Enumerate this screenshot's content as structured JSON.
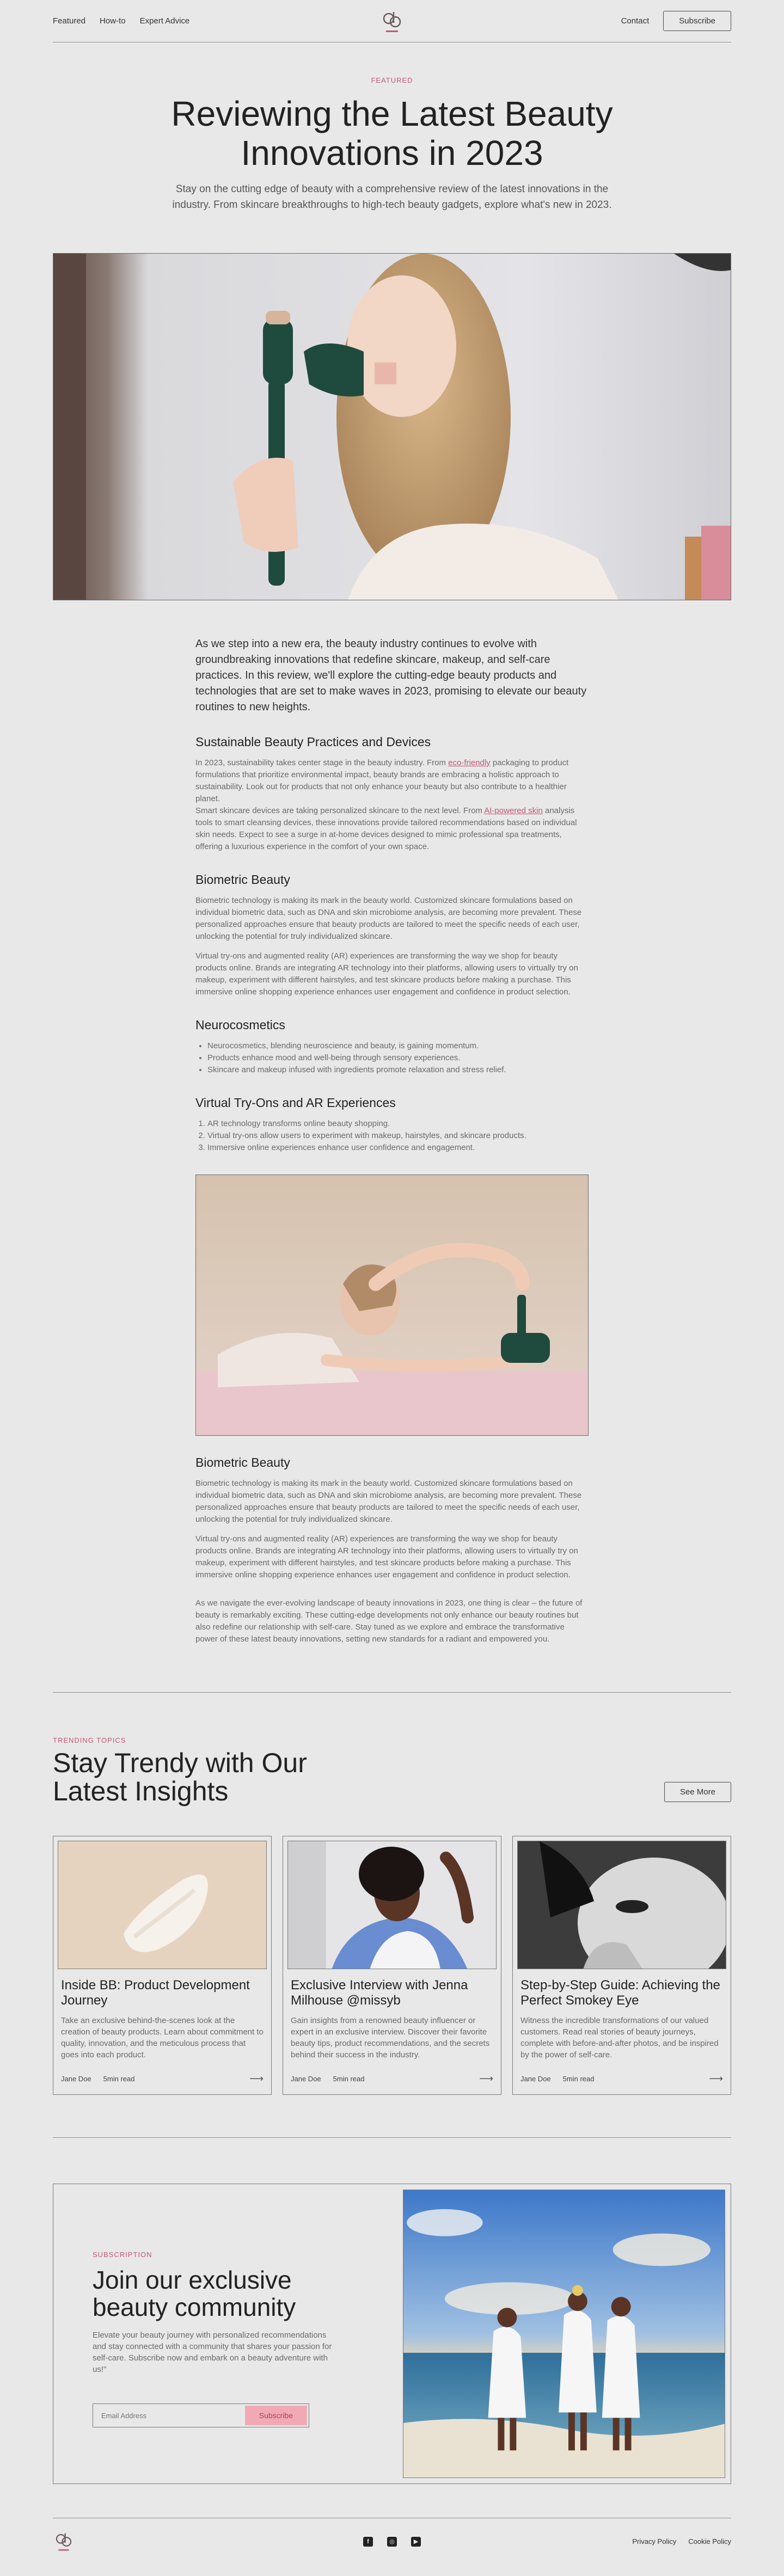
{
  "nav": {
    "featured": "Featured",
    "howto": "How-to",
    "expert": "Expert Advice",
    "contact": "Contact",
    "subscribe": "Subscribe"
  },
  "hero": {
    "eyebrow": "FEATURED",
    "title_line1": "Reviewing the Latest Beauty",
    "title_line2": "Innovations in 2023",
    "subtitle": "Stay on the cutting edge of beauty with a comprehensive review of the latest innovations in the industry. From skincare breakthroughs to high-tech beauty gadgets, explore what's new in 2023."
  },
  "article": {
    "lead": "As we step into a new era, the beauty industry continues to evolve with groundbreaking innovations that redefine skincare, makeup, and self-care practices. In this review, we'll explore the cutting-edge beauty products and technologies that are set to make waves in 2023, promising to elevate our beauty routines to new heights.",
    "h_sustainable": "Sustainable Beauty Practices and Devices",
    "p_sust_1a": "In 2023, sustainability takes center stage in the beauty industry. From ",
    "p_sust_link1": "eco-friendly",
    "p_sust_1b": " packaging to product formulations that prioritize environmental impact, beauty brands are embracing a holistic approach to sustainability. Look out for products that not only enhance your beauty but also contribute to a healthier planet.",
    "p_sust_2a": "Smart skincare devices are taking personalized skincare to the next level. From ",
    "p_sust_link2": "AI-powered skin",
    "p_sust_2b": " analysis tools to smart cleansing devices, these innovations provide tailored recommendations based on individual skin needs. Expect to see a surge in at-home devices designed to mimic professional spa treatments, offering a luxurious experience in the comfort of your own space.",
    "h_bio": "Biometric Beauty",
    "p_bio_1": "Biometric technology is making its mark in the beauty world. Customized skincare formulations based on individual biometric data, such as DNA and skin microbiome analysis, are becoming more prevalent. These personalized approaches ensure that beauty products are tailored to meet the specific needs of each user, unlocking the potential for truly individualized skincare.",
    "p_bio_2": "Virtual try-ons and augmented reality (AR) experiences are transforming the way we shop for beauty products online. Brands are integrating AR technology into their platforms, allowing users to virtually try on makeup, experiment with different hairstyles, and test skincare products before making a purchase. This immersive online shopping experience enhances user engagement and confidence in product selection.",
    "h_neuro": "Neurocosmetics",
    "neuro_items": [
      "Neurocosmetics, blending neuroscience and beauty, is gaining momentum.",
      "Products enhance mood and well-being through sensory experiences.",
      "Skincare and makeup infused with ingredients promote relaxation and stress relief."
    ],
    "h_ar": "Virtual Try-Ons and AR Experiences",
    "ar_items": [
      "AR technology transforms online beauty shopping.",
      "Virtual try-ons allow users to experiment with makeup, hairstyles, and skincare products.",
      "Immersive online experiences enhance user confidence and engagement."
    ],
    "h_bio2": "Biometric Beauty",
    "p_bio2_1": "Biometric technology is making its mark in the beauty world. Customized skincare formulations based on individual biometric data, such as DNA and skin microbiome analysis, are becoming more prevalent. These personalized approaches ensure that beauty products are tailored to meet the specific needs of each user, unlocking the potential for truly individualized skincare.",
    "p_bio2_2": "Virtual try-ons and augmented reality (AR) experiences are transforming the way we shop for beauty products online. Brands are integrating AR technology into their platforms, allowing users to virtually try on makeup, experiment with different hairstyles, and test skincare products before making a purchase. This immersive online shopping experience enhances user engagement and confidence in product selection.",
    "p_closing": "As we navigate the ever-evolving landscape of beauty innovations in 2023, one thing is clear – the future of beauty is remarkably exciting. These cutting-edge developments not only enhance our beauty routines but also redefine our relationship with self-care. Stay tuned as we explore and embrace the transformative power of these latest beauty innovations, setting new standards for a radiant and empowered you."
  },
  "trending": {
    "eyebrow": "TRENDING TOPICS",
    "title_line1": "Stay Trendy with Our",
    "title_line2": "Latest Insights",
    "see_more": "See More",
    "cards": [
      {
        "title": "Inside BB: Product Development Journey",
        "desc": "Take an exclusive behind-the-scenes look at the creation of beauty products. Learn about commitment to quality, innovation, and the meticulous process that goes into each product.",
        "author": "Jane Doe",
        "time": "5min read"
      },
      {
        "title": "Exclusive Interview with Jenna Milhouse @missyb",
        "desc": "Gain insights from a renowned beauty influencer or expert in an exclusive interview. Discover their favorite beauty tips, product recommendations, and the secrets behind their success in the industry.",
        "author": "Jane Doe",
        "time": "5min read"
      },
      {
        "title": "Step-by-Step Guide: Achieving the Perfect Smokey Eye",
        "desc": "Witness the incredible transformations of our valued customers. Read real stories of beauty journeys, complete with before-and-after photos, and be inspired by the power of self-care.",
        "author": "Jane Doe",
        "time": "5min read"
      }
    ]
  },
  "subscribe": {
    "eyebrow": "SUBSCRIPTION",
    "title_line1": "Join our exclusive",
    "title_line2": "beauty community",
    "desc": "Elevate your beauty journey with personalized recommendations and stay connected with a community that shares your passion for self-care. Subscribe now and embark on a beauty adventure with us!\"",
    "placeholder": "Email Address",
    "button": "Subscribe"
  },
  "footer": {
    "privacy": "Privacy Policy",
    "cookie": "Cookie Policy"
  },
  "colors": {
    "accent": "#c25876",
    "button_pink": "#f2a9b6",
    "bg": "#e8e8e8"
  }
}
